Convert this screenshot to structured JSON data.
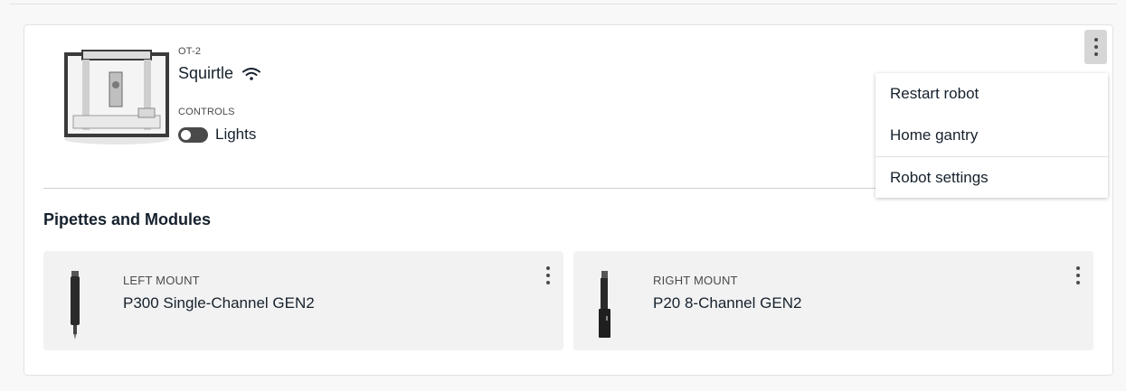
{
  "robot": {
    "model": "OT-2",
    "name": "Squirtle",
    "connection_icon": "wifi-icon",
    "controls_label": "CONTROLS",
    "lights_label": "Lights",
    "lights_on": false
  },
  "section": {
    "title": "Pipettes and Modules"
  },
  "mounts": [
    {
      "label": "LEFT MOUNT",
      "pipette": "P300 Single-Channel GEN2"
    },
    {
      "label": "RIGHT MOUNT",
      "pipette": "P20 8-Channel GEN2"
    }
  ],
  "menu": {
    "items": [
      {
        "label": "Restart robot"
      },
      {
        "label": "Home gantry"
      },
      {
        "label": "Robot settings"
      }
    ]
  },
  "colors": {
    "text": "#16212d",
    "muted": "#4a4a4a",
    "card_bg": "#ffffff",
    "tile_bg": "#f2f2f2",
    "button_bg": "#d6d6d6"
  }
}
